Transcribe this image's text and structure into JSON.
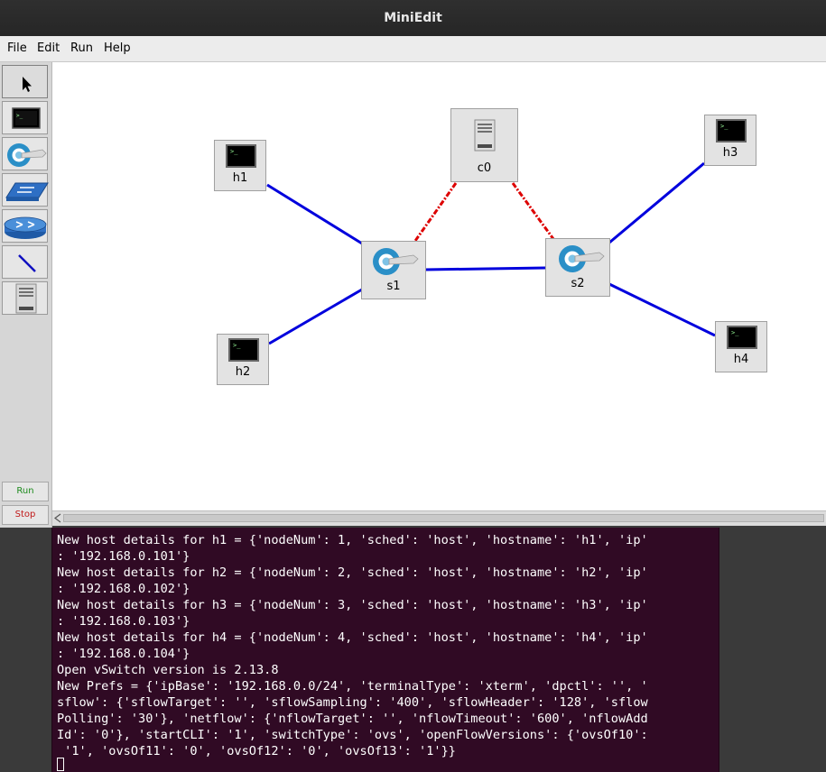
{
  "window": {
    "title": "MiniEdit"
  },
  "menu": {
    "file": "File",
    "edit": "Edit",
    "run": "Run",
    "help": "Help"
  },
  "toolbar": {
    "tools": [
      {
        "name": "select",
        "icon": "pointer-icon"
      },
      {
        "name": "host",
        "icon": "terminal-icon"
      },
      {
        "name": "switch",
        "icon": "openvswitch-icon"
      },
      {
        "name": "legacy-switch",
        "icon": "legacy-switch-icon"
      },
      {
        "name": "legacy-router",
        "icon": "router-icon"
      },
      {
        "name": "link",
        "icon": "link-line-icon"
      },
      {
        "name": "controller",
        "icon": "server-icon"
      }
    ],
    "run_label": "Run",
    "stop_label": "Stop"
  },
  "topology": {
    "nodes": [
      {
        "id": "h1",
        "label": "h1",
        "type": "host"
      },
      {
        "id": "h2",
        "label": "h2",
        "type": "host"
      },
      {
        "id": "h3",
        "label": "h3",
        "type": "host"
      },
      {
        "id": "h4",
        "label": "h4",
        "type": "host"
      },
      {
        "id": "s1",
        "label": "s1",
        "type": "switch"
      },
      {
        "id": "s2",
        "label": "s2",
        "type": "switch"
      },
      {
        "id": "c0",
        "label": "c0",
        "type": "controller"
      }
    ],
    "links": [
      {
        "from": "h1",
        "to": "s1",
        "kind": "data"
      },
      {
        "from": "h2",
        "to": "s1",
        "kind": "data"
      },
      {
        "from": "s1",
        "to": "s2",
        "kind": "data"
      },
      {
        "from": "s2",
        "to": "h3",
        "kind": "data"
      },
      {
        "from": "s2",
        "to": "h4",
        "kind": "data"
      },
      {
        "from": "c0",
        "to": "s1",
        "kind": "control"
      },
      {
        "from": "c0",
        "to": "s2",
        "kind": "control"
      }
    ],
    "colors": {
      "data_link": "#0000dd",
      "control_link": "#dd0000"
    }
  },
  "terminal": {
    "lines": [
      "New host details for h1 = {'nodeNum': 1, 'sched': 'host', 'hostname': 'h1', 'ip'",
      ": '192.168.0.101'}",
      "New host details for h2 = {'nodeNum': 2, 'sched': 'host', 'hostname': 'h2', 'ip'",
      ": '192.168.0.102'}",
      "New host details for h3 = {'nodeNum': 3, 'sched': 'host', 'hostname': 'h3', 'ip'",
      ": '192.168.0.103'}",
      "New host details for h4 = {'nodeNum': 4, 'sched': 'host', 'hostname': 'h4', 'ip'",
      ": '192.168.0.104'}",
      "Open vSwitch version is 2.13.8",
      "New Prefs = {'ipBase': '192.168.0.0/24', 'terminalType': 'xterm', 'dpctl': '', '",
      "sflow': {'sflowTarget': '', 'sflowSampling': '400', 'sflowHeader': '128', 'sflow",
      "Polling': '30'}, 'netflow': {'nflowTarget': '', 'nflowTimeout': '600', 'nflowAdd",
      "Id': '0'}, 'startCLI': '1', 'switchType': 'ovs', 'openFlowVersions': {'ovsOf10':",
      " '1', 'ovsOf11': '0', 'ovsOf12': '0', 'ovsOf13': '1'}}"
    ]
  }
}
